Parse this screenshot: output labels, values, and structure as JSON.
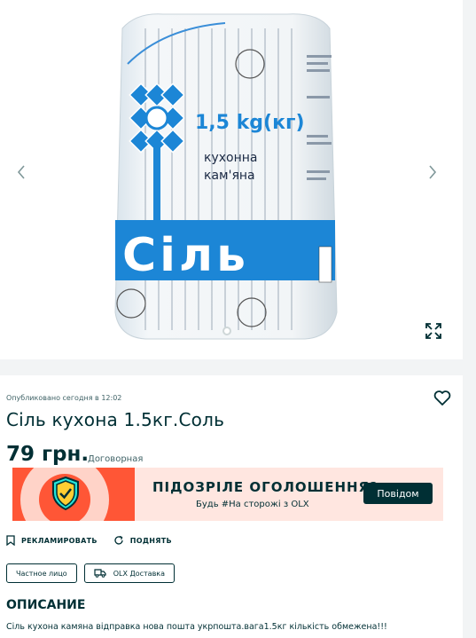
{
  "gallery": {
    "prev_icon": "chevron-left-icon",
    "next_icon": "chevron-right-icon",
    "expand_icon": "fullscreen-icon",
    "package": {
      "weight": "1,5 kg(кг)",
      "line1": "кухонна",
      "line2": "кам'яна",
      "brand_word": "Сіль"
    }
  },
  "listing": {
    "posted": "Опубликовано сегодня в 12:02",
    "title": "Сіль кухона 1.5кг.Соль",
    "price": "79 грн.",
    "negotiable": "Договорная",
    "favorite_icon": "heart-icon"
  },
  "banner": {
    "title": "ПІДОЗРІЛЕ ОГОЛОШЕННЯ?",
    "subtitle": "Будь #На сторожі з OLX",
    "button": "Повідом",
    "icon": "shield-check-icon",
    "colors": {
      "accent": "#ff5636",
      "background": "#ffe6e0",
      "button": "#002f34"
    }
  },
  "actions": [
    {
      "label": "РЕКЛАМИРОВАТЬ",
      "icon": "bookmark-icon"
    },
    {
      "label": "ПОДНЯТЬ",
      "icon": "refresh-icon"
    }
  ],
  "tags": [
    {
      "label": "Частное лицо"
    },
    {
      "label": "OLX Доставка",
      "icon": "truck-icon"
    }
  ],
  "description": {
    "heading": "ОПИСАНИЕ",
    "text": "Сіль кухона камяна відправка нова пошта укрпошта.вага1.5кг кількість обмежена!!!"
  }
}
